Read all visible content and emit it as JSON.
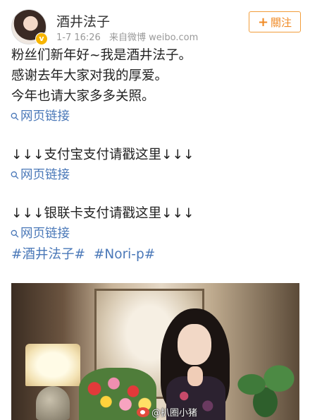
{
  "post": {
    "username": "酒井法子",
    "date": "1-7 16:26",
    "source": "来自微博 weibo.com",
    "follow_label": "關注",
    "follow_plus": "+",
    "verified_mark": "v",
    "lines": [
      "粉丝们新年好~我是酒井法子。",
      "感谢去年大家对我的厚爱。",
      "今年也请大家多多关照。"
    ],
    "link_icon": "link-icon",
    "links": [
      {
        "label": "网页链接"
      },
      {
        "label": "网页链接"
      },
      {
        "label": "网页链接"
      }
    ],
    "alipay_line": "↓↓↓支付宝支付请戳这里↓↓↓",
    "unionpay_line": "↓↓↓银联卡支付请戳这里↓↓↓",
    "tags": [
      "#酒井法子#",
      "#Nori-p#"
    ]
  },
  "photo": {
    "watermark": "@扒圈小猪",
    "watermark_icon": "weibo-logo-icon"
  },
  "colors": {
    "link": "#4a78b8",
    "follow": "#f08a24",
    "verified": "#f7b500"
  }
}
